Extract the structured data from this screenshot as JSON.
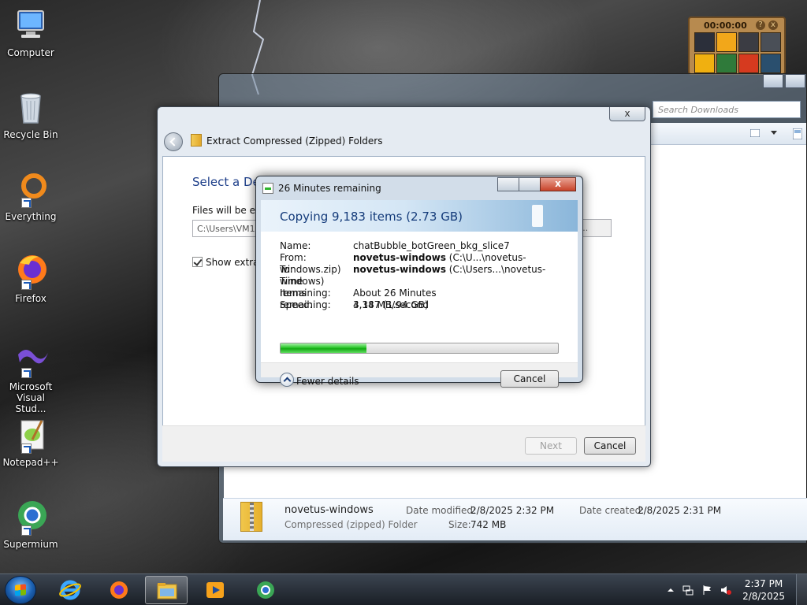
{
  "desktop": {
    "icons": [
      {
        "label": "Computer"
      },
      {
        "label": "Recycle Bin"
      },
      {
        "label": "Everything"
      },
      {
        "label": "Firefox"
      },
      {
        "label": "Microsoft Visual Stud..."
      },
      {
        "label": "Notepad++"
      },
      {
        "label": "Supermium"
      }
    ]
  },
  "gadget": {
    "timer": "00:00:00",
    "help": "?",
    "close": "x"
  },
  "explorer": {
    "search_placeholder": "Search Downloads",
    "details": {
      "name": "novetus-windows",
      "type": "Compressed (zipped) Folder",
      "date_modified_label": "Date modified:",
      "date_modified": "2/8/2025 2:32 PM",
      "date_created_label": "Date created:",
      "date_created": "2/8/2025 2:31 PM",
      "size_label": "Size:",
      "size": "742 MB"
    }
  },
  "wizard": {
    "title": "Extract Compressed (Zipped) Folders",
    "heading": "Select a Dest",
    "files_label": "Files will be extr",
    "path_value": "C:\\Users\\VM1",
    "browse_label": "e...",
    "show_label": "Show extract",
    "next_label": "Next",
    "cancel_label": "Cancel",
    "close_glyph": "x"
  },
  "copy": {
    "title": "26 Minutes remaining",
    "header": "Copying 9,183 items (2.73 GB)",
    "rows": {
      "name_label": "Name:",
      "name_value": "chatBubble_botGreen_bkg_slice7",
      "from_label": "From:",
      "from_bold": "novetus-windows",
      "from_rest": " (C:\\U...\\novetus-windows.zip)",
      "to_label": "To:",
      "to_bold": "novetus-windows",
      "to_rest": " (C:\\Users...\\novetus-windows)",
      "time_label": "Time remaining:",
      "time_value": "About 26 Minutes",
      "items_label": "Items remaining:",
      "items_value": "4,147 (1.94 GB)",
      "speed_label": "Speed:",
      "speed_value": "3.38 MB/second"
    },
    "progress": 0.31,
    "fewer_label": "Fewer details",
    "cancel_label": "Cancel",
    "close_glyph": "x"
  },
  "taskbar": {
    "time": "2:37 PM",
    "date": "2/8/2025"
  }
}
